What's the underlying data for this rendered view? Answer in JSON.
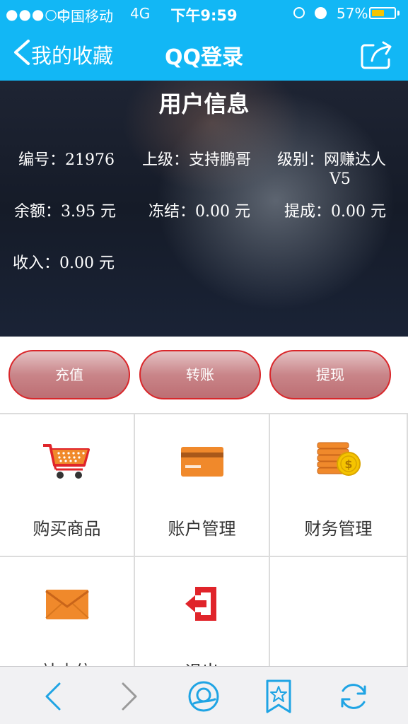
{
  "status_bar": {
    "signal": "●●●○○",
    "carrier": "中国移动",
    "network": "4G",
    "time": "下午9:59",
    "battery_percent": "57%",
    "battery_level": 0.57,
    "icons": [
      "lock-rotation-icon",
      "alarm-icon",
      "battery-icon"
    ]
  },
  "nav": {
    "back_label": "我的收藏",
    "title": "QQ登录",
    "icons": [
      "back-chevron-icon",
      "share-icon"
    ]
  },
  "user_info": {
    "title": "用户信息",
    "id_label": "编号：",
    "id_value": "21976",
    "superior_label": "上级：",
    "superior_value": "支持鹏哥",
    "level_label": "级别：",
    "level_value_line1": "网赚达人",
    "level_value_line2": "V5",
    "balance_label": "余额：",
    "balance_value": "3.95 元",
    "frozen_label": "冻结：",
    "frozen_value": "0.00 元",
    "commission_label": "提成：",
    "commission_value": "0.00 元",
    "income_label": "收入：",
    "income_value": "0.00 元"
  },
  "actions": {
    "recharge": "充值",
    "transfer": "转账",
    "withdraw": "提现"
  },
  "menu": {
    "items": [
      {
        "label": "购买商品",
        "icon": "shopping-cart-icon"
      },
      {
        "label": "账户管理",
        "icon": "credit-card-icon"
      },
      {
        "label": "财务管理",
        "icon": "coins-icon"
      },
      {
        "label": "站内信",
        "icon": "envelope-icon"
      },
      {
        "label": "退出",
        "icon": "exit-icon"
      }
    ]
  },
  "colors": {
    "primary_blue": "#12b7f5",
    "button_border": "#d9262a",
    "icon_orange": "#f0892b",
    "icon_red": "#e0242a"
  },
  "toolbar": {
    "icons": [
      "back-arrow-icon",
      "forward-arrow-icon",
      "qq-browser-icon",
      "bookmark-star-icon",
      "refresh-icon"
    ]
  }
}
